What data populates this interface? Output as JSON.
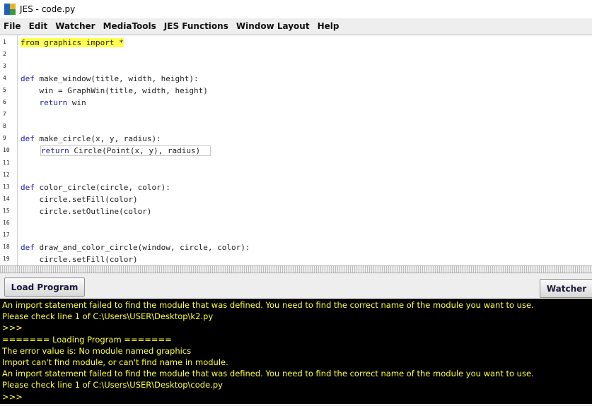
{
  "window": {
    "title": "JES - code.py"
  },
  "menu": [
    "File",
    "Edit",
    "Watcher",
    "MediaTools",
    "JES Functions",
    "Window Layout",
    "Help"
  ],
  "editor": {
    "lines": [
      {
        "n": "1",
        "kw": "",
        "text": "from graphics import *",
        "hl": true
      },
      {
        "n": "2",
        "kw": "",
        "text": ""
      },
      {
        "n": "3",
        "kw": "",
        "text": ""
      },
      {
        "n": "4",
        "kw": "def",
        "text": " make_window(title, width, height):"
      },
      {
        "n": "5",
        "kw": "",
        "text": "    win = GraphWin(title, width, height)"
      },
      {
        "n": "6",
        "kw": "    return",
        "text": " win"
      },
      {
        "n": "7",
        "kw": "",
        "text": ""
      },
      {
        "n": "8",
        "kw": "",
        "text": ""
      },
      {
        "n": "9",
        "kw": "def",
        "text": " make_circle(x, y, radius):"
      },
      {
        "n": "10",
        "kw": "return",
        "text": " Circle(Point(x, y), radius)",
        "box": true
      },
      {
        "n": "11",
        "kw": "",
        "text": ""
      },
      {
        "n": "12",
        "kw": "",
        "text": ""
      },
      {
        "n": "13",
        "kw": "def",
        "text": " color_circle(circle, color):"
      },
      {
        "n": "14",
        "kw": "",
        "text": "    circle.setFill(color)"
      },
      {
        "n": "15",
        "kw": "",
        "text": "    circle.setOutline(color)"
      },
      {
        "n": "16",
        "kw": "",
        "text": ""
      },
      {
        "n": "17",
        "kw": "",
        "text": ""
      },
      {
        "n": "18",
        "kw": "def",
        "text": " draw_and_color_circle(window, circle, color):"
      },
      {
        "n": "19",
        "kw": "",
        "text": "    circle.setFill(color)"
      }
    ]
  },
  "buttons": {
    "load": "Load Program",
    "watcher": "Watcher"
  },
  "console": {
    "lines": [
      "An import statement failed to find the module that was defined. You need to find the correct name of the module you want to use.",
      "Please check line 1 of C:\\Users\\USER\\Desktop\\k2.py",
      ">>>",
      "======= Loading Program =======",
      "The error value is: No module named graphics",
      "Import can't find module, or can't find name in module.",
      "An import statement failed to find the module that was defined. You need to find the correct name of the module you want to use.",
      "Please check line 1 of C:\\Users\\USER\\Desktop\\code.py",
      ">>>"
    ]
  }
}
